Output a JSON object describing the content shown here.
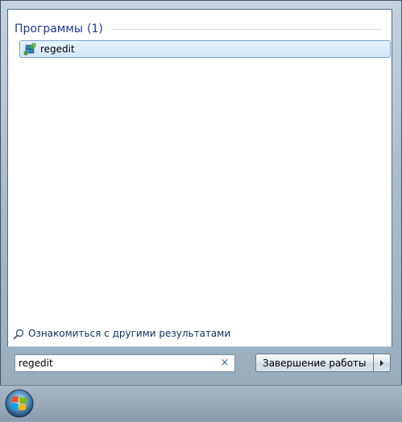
{
  "results": {
    "section_title": "Программы",
    "section_count": "(1)",
    "items": [
      {
        "label": "regedit",
        "icon": "regedit-icon"
      }
    ],
    "more_results_label": "Ознакомиться с другими результатами"
  },
  "search": {
    "value": "regedit",
    "clear_symbol": "×"
  },
  "power": {
    "shutdown_label": "Завершение работы"
  },
  "colors": {
    "section_title": "#1e3a8a",
    "selection_border": "#7da2ce",
    "link_text": "#10305c"
  }
}
